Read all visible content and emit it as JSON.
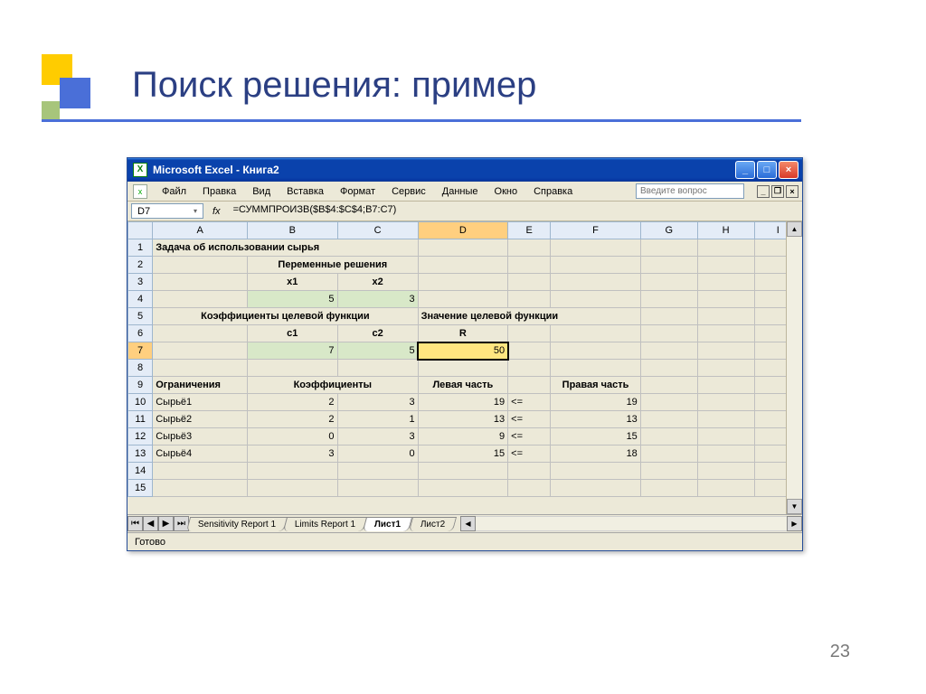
{
  "slide": {
    "title": "Поиск решения: пример",
    "page_number": "23"
  },
  "window": {
    "title": "Microsoft Excel - Книга2",
    "menu": {
      "file": "Файл",
      "edit": "Правка",
      "view": "Вид",
      "insert": "Вставка",
      "format": "Формат",
      "tools": "Сервис",
      "data": "Данные",
      "window": "Окно",
      "help": "Справка"
    },
    "askbox_placeholder": "Введите вопрос",
    "namebox": "D7",
    "fx_label": "fx",
    "formula": "=СУММПРОИЗВ($B$4:$C$4;B7:C7)",
    "status": "Готово"
  },
  "columns": [
    "A",
    "B",
    "C",
    "D",
    "E",
    "F",
    "G",
    "H",
    "I"
  ],
  "rows": [
    "1",
    "2",
    "3",
    "4",
    "5",
    "6",
    "7",
    "8",
    "9",
    "10",
    "11",
    "12",
    "13",
    "14",
    "15"
  ],
  "cells": {
    "r1": {
      "A": "Задача об использовании сырья"
    },
    "r2": {
      "B": "Переменные решения"
    },
    "r3": {
      "B": "x1",
      "C": "x2"
    },
    "r4": {
      "B": "5",
      "C": "3"
    },
    "r5": {
      "A": "Коэффициенты целевой функции",
      "D": "Значение целевой функции"
    },
    "r6": {
      "B": "c1",
      "C": "c2",
      "D": "R"
    },
    "r7": {
      "B": "7",
      "C": "5",
      "D": "50"
    },
    "r9": {
      "A": "Ограничения",
      "B": "Коэффициенты",
      "D": "Левая часть",
      "F": "Правая часть"
    },
    "r10": {
      "A": "Сырьё1",
      "B": "2",
      "C": "3",
      "D": "19",
      "E": "<=",
      "F": "19"
    },
    "r11": {
      "A": "Сырьё2",
      "B": "2",
      "C": "1",
      "D": "13",
      "E": "<=",
      "F": "13"
    },
    "r12": {
      "A": "Сырьё3",
      "B": "0",
      "C": "3",
      "D": "9",
      "E": "<=",
      "F": "15"
    },
    "r13": {
      "A": "Сырьё4",
      "B": "3",
      "C": "0",
      "D": "15",
      "E": "<=",
      "F": "18"
    }
  },
  "tabs": {
    "t1": "Sensitivity Report 1",
    "t2": "Limits Report 1",
    "t3": "Лист1",
    "t4": "Лист2"
  }
}
